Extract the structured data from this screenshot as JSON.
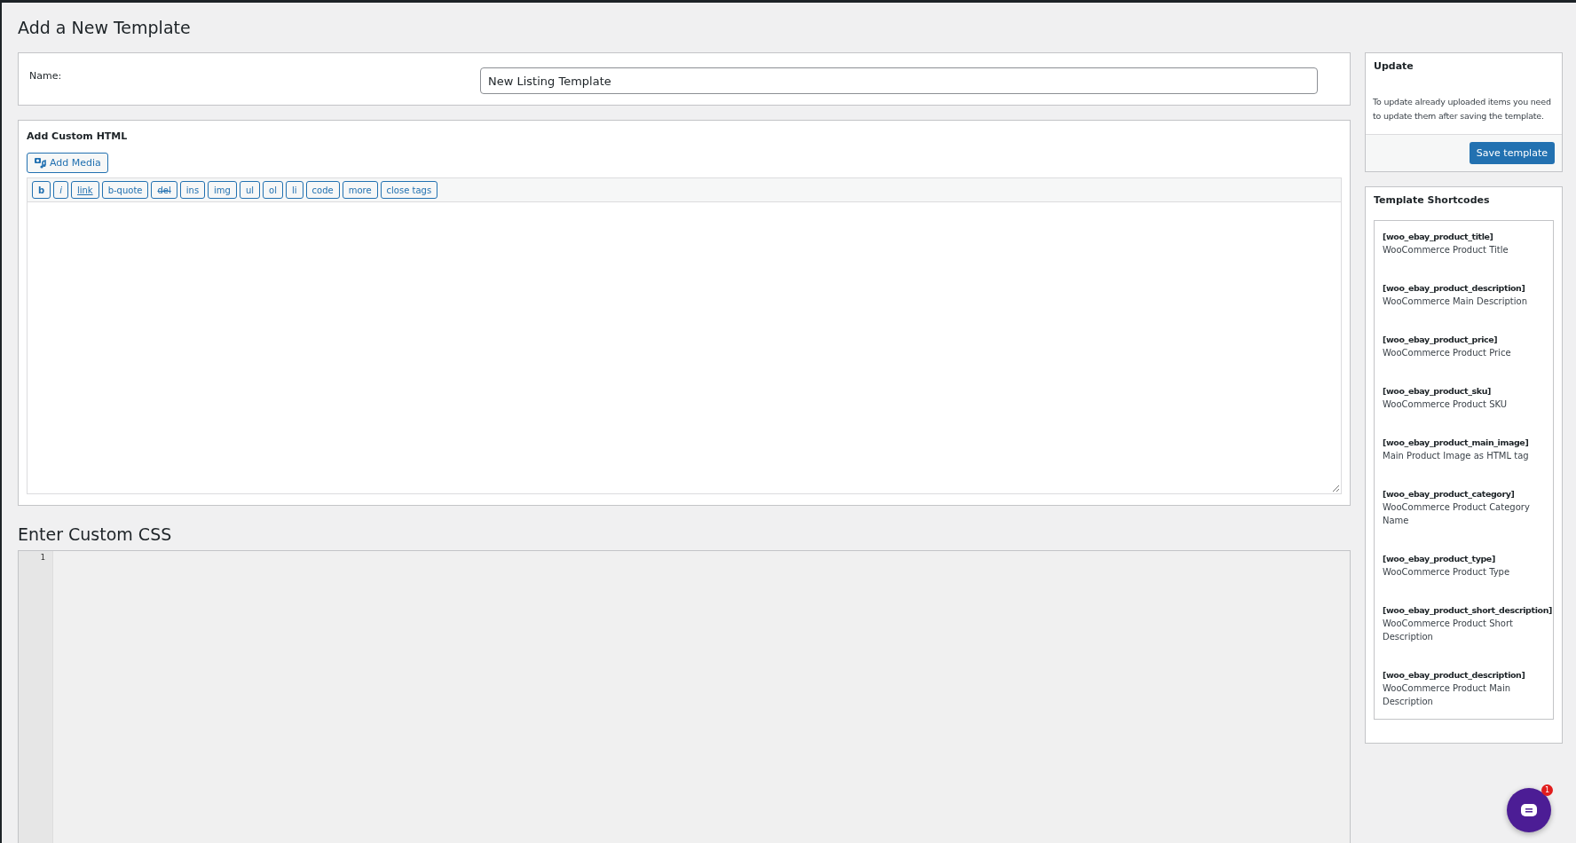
{
  "page_title": "Add a New Template",
  "name_field": {
    "label": "Name:",
    "value": "New Listing Template"
  },
  "html_panel": {
    "title": "Add Custom HTML",
    "media_button": "Add Media",
    "toolbar": [
      {
        "label": "b",
        "kind": "bold"
      },
      {
        "label": "i",
        "kind": "italic"
      },
      {
        "label": "link",
        "kind": "underline"
      },
      {
        "label": "b-quote",
        "kind": "plain"
      },
      {
        "label": "del",
        "kind": "strike"
      },
      {
        "label": "ins",
        "kind": "plain"
      },
      {
        "label": "img",
        "kind": "plain"
      },
      {
        "label": "ul",
        "kind": "plain"
      },
      {
        "label": "ol",
        "kind": "plain"
      },
      {
        "label": "li",
        "kind": "plain"
      },
      {
        "label": "code",
        "kind": "plain"
      },
      {
        "label": "more",
        "kind": "plain"
      },
      {
        "label": "close tags",
        "kind": "plain"
      }
    ]
  },
  "css_panel": {
    "title": "Enter Custom CSS",
    "line_numbers": [
      "1"
    ]
  },
  "update_panel": {
    "title": "Update",
    "text": "To update already uploaded items you need to update them after saving the template.",
    "button": "Save template"
  },
  "shortcodes_panel": {
    "title": "Template Shortcodes",
    "items": [
      {
        "code": "[woo_ebay_product_title]",
        "description": "WooCommerce Product Title"
      },
      {
        "code": "[woo_ebay_product_description]",
        "description": "WooCommerce Main Description"
      },
      {
        "code": "[woo_ebay_product_price]",
        "description": "WooCommerce Product Price"
      },
      {
        "code": "[woo_ebay_product_sku]",
        "description": "WooCommerce Product SKU"
      },
      {
        "code": "[woo_ebay_product_main_image]",
        "description": "Main Product Image as HTML tag"
      },
      {
        "code": "[woo_ebay_product_category]",
        "description": "WooCommerce Product Category Name"
      },
      {
        "code": "[woo_ebay_product_type]",
        "description": "WooCommerce Product Type"
      },
      {
        "code": "[woo_ebay_product_short_description]",
        "description": "WooCommerce Product Short Description"
      },
      {
        "code": "[woo_ebay_product_description]",
        "description": "WooCommerce Product Main Description"
      }
    ]
  },
  "chat_widget": {
    "badge": "1"
  }
}
